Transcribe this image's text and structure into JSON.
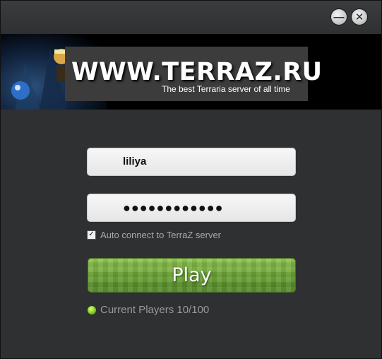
{
  "window": {
    "minimize_glyph": "—",
    "close_glyph": "✕"
  },
  "banner": {
    "title": "WWW.TERRAZ.RU",
    "subtitle": "The best Terraria server of all time"
  },
  "login": {
    "username_value": "liliya",
    "password_value": "●●●●●●●●●●●●",
    "auto_connect_checked": true,
    "auto_connect_label": "Auto connect to TerraZ server",
    "play_label": "Play"
  },
  "status": {
    "text": "Current Players 10/100",
    "color": "#7cc41f"
  }
}
